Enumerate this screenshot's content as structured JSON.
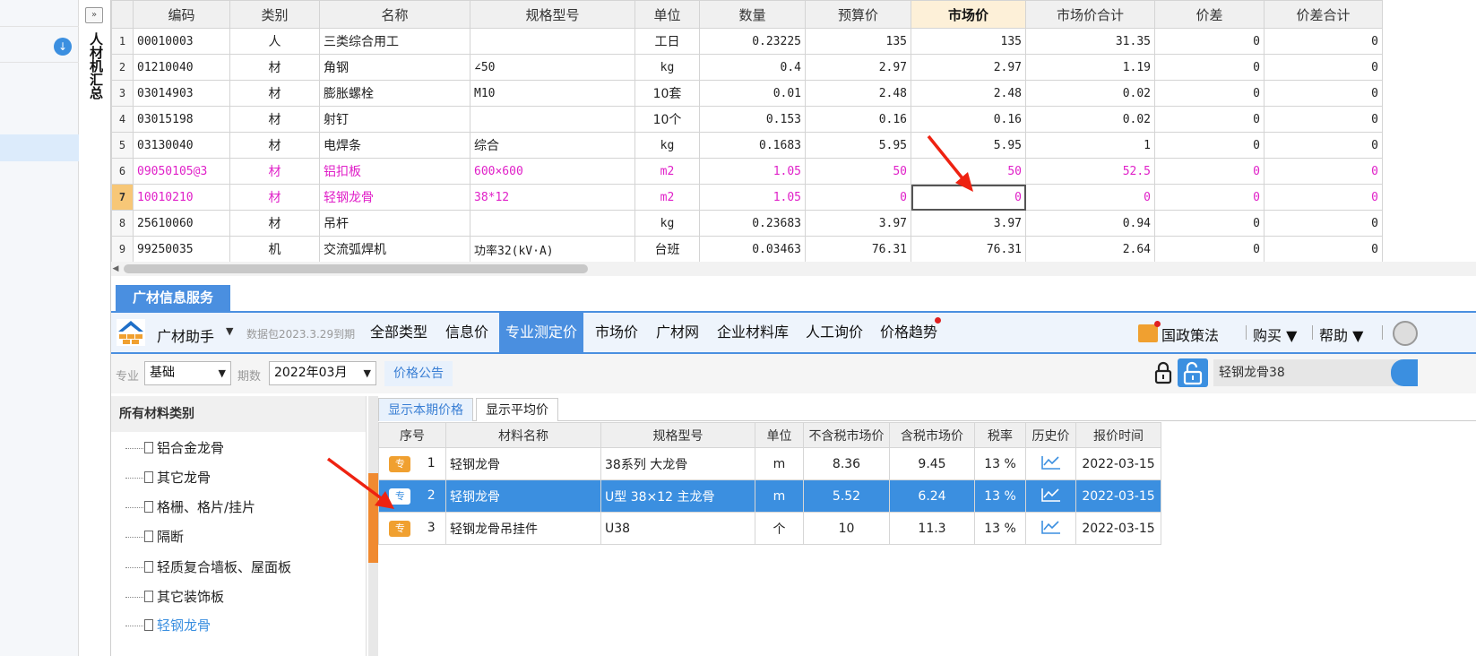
{
  "sidebar": {
    "download_icon": "download-icon"
  },
  "vertical_tab": {
    "expand": "»",
    "label": "人材机汇总"
  },
  "grid": {
    "headers": [
      "编码",
      "类别",
      "名称",
      "规格型号",
      "单位",
      "数量",
      "预算价",
      "市场价",
      "市场价合计",
      "价差",
      "价差合计"
    ],
    "rows": [
      {
        "idx": "1",
        "code": "00010003",
        "type": "人",
        "name": "三类综合用工",
        "spec": "",
        "unit": "工日",
        "qty": "0.23225",
        "budget": "135",
        "market": "135",
        "market_total": "31.35",
        "diff": "0",
        "diff_total": "0"
      },
      {
        "idx": "2",
        "code": "01210040",
        "type": "材",
        "name": "角钢",
        "spec": "∠50",
        "unit": "kg",
        "qty": "0.4",
        "budget": "2.97",
        "market": "2.97",
        "market_total": "1.19",
        "diff": "0",
        "diff_total": "0"
      },
      {
        "idx": "3",
        "code": "03014903",
        "type": "材",
        "name": "膨胀螺栓",
        "spec": "M10",
        "unit": "10套",
        "qty": "0.01",
        "budget": "2.48",
        "market": "2.48",
        "market_total": "0.02",
        "diff": "0",
        "diff_total": "0"
      },
      {
        "idx": "4",
        "code": "03015198",
        "type": "材",
        "name": "射钉",
        "spec": "",
        "unit": "10个",
        "qty": "0.153",
        "budget": "0.16",
        "market": "0.16",
        "market_total": "0.02",
        "diff": "0",
        "diff_total": "0"
      },
      {
        "idx": "5",
        "code": "03130040",
        "type": "材",
        "name": "电焊条",
        "spec": "综合",
        "unit": "kg",
        "qty": "0.1683",
        "budget": "5.95",
        "market": "5.95",
        "market_total": "1",
        "diff": "0",
        "diff_total": "0"
      },
      {
        "idx": "6",
        "code": "09050105@3",
        "type": "材",
        "name": "铝扣板",
        "spec": "600×600",
        "unit": "m2",
        "qty": "1.05",
        "budget": "50",
        "market": "50",
        "market_total": "52.5",
        "diff": "0",
        "diff_total": "0"
      },
      {
        "idx": "7",
        "code": "10010210",
        "type": "材",
        "name": "轻钢龙骨",
        "spec": "38*12",
        "unit": "m2",
        "qty": "1.05",
        "budget": "0",
        "market": "0",
        "market_total": "0",
        "diff": "0",
        "diff_total": "0"
      },
      {
        "idx": "8",
        "code": "25610060",
        "type": "材",
        "name": "吊杆",
        "spec": "",
        "unit": "kg",
        "qty": "0.23683",
        "budget": "3.97",
        "market": "3.97",
        "market_total": "0.94",
        "diff": "0",
        "diff_total": "0"
      },
      {
        "idx": "9",
        "code": "99250035",
        "type": "机",
        "name": "交流弧焊机",
        "spec": "功率32(kV·A)",
        "unit": "台班",
        "qty": "0.03463",
        "budget": "76.31",
        "market": "76.31",
        "market_total": "2.64",
        "diff": "0",
        "diff_total": "0"
      }
    ]
  },
  "panel": {
    "tab": "广材信息服务",
    "brand": "广材助手",
    "brand_caret": "▼",
    "expiry": "数据包2023.3.29到期",
    "nav": [
      "全部类型",
      "信息价",
      "专业测定价",
      "市场价",
      "广材网",
      "企业材料库",
      "人工询价",
      "价格趋势"
    ],
    "active_nav": "专业测定价",
    "policy": "国政策法",
    "buy": "购买 ▼",
    "help": "帮助 ▼",
    "filter": {
      "major_label": "专业",
      "major_value": "基础",
      "period_label": "期数",
      "period_value": "2022年03月",
      "caret": "▼",
      "notice": "价格公告",
      "search_value": "轻钢龙骨38"
    },
    "tree": {
      "header": "所有材料类别",
      "items": [
        "铝合金龙骨",
        "其它龙骨",
        "格栅、格片/挂片",
        "隔断",
        "轻质复合墙板、屋面板",
        "其它装饰板",
        "轻钢龙骨"
      ]
    },
    "subtabs": [
      "显示本期价格",
      "显示平均价"
    ],
    "price_headers": [
      "序号",
      "材料名称",
      "规格型号",
      "单位",
      "不含税市场价",
      "含税市场价",
      "税率",
      "历史价",
      "报价时间"
    ],
    "badge": "专",
    "price_rows": [
      {
        "no": "1",
        "name": "轻钢龙骨",
        "spec": "38系列 大龙骨",
        "unit": "m",
        "ex_tax": "8.36",
        "in_tax": "9.45",
        "rate": "13 %",
        "date": "2022-03-15"
      },
      {
        "no": "2",
        "name": "轻钢龙骨",
        "spec": "U型 38×12 主龙骨",
        "unit": "m",
        "ex_tax": "5.52",
        "in_tax": "6.24",
        "rate": "13 %",
        "date": "2022-03-15"
      },
      {
        "no": "3",
        "name": "轻钢龙骨吊挂件",
        "spec": "U38",
        "unit": "个",
        "ex_tax": "10",
        "in_tax": "11.3",
        "rate": "13 %",
        "date": "2022-03-15"
      }
    ]
  },
  "colors": {
    "accent": "#3b8fe0",
    "pink": "#e020c8",
    "orange": "#f0a030",
    "arrow": "#ee2211"
  }
}
